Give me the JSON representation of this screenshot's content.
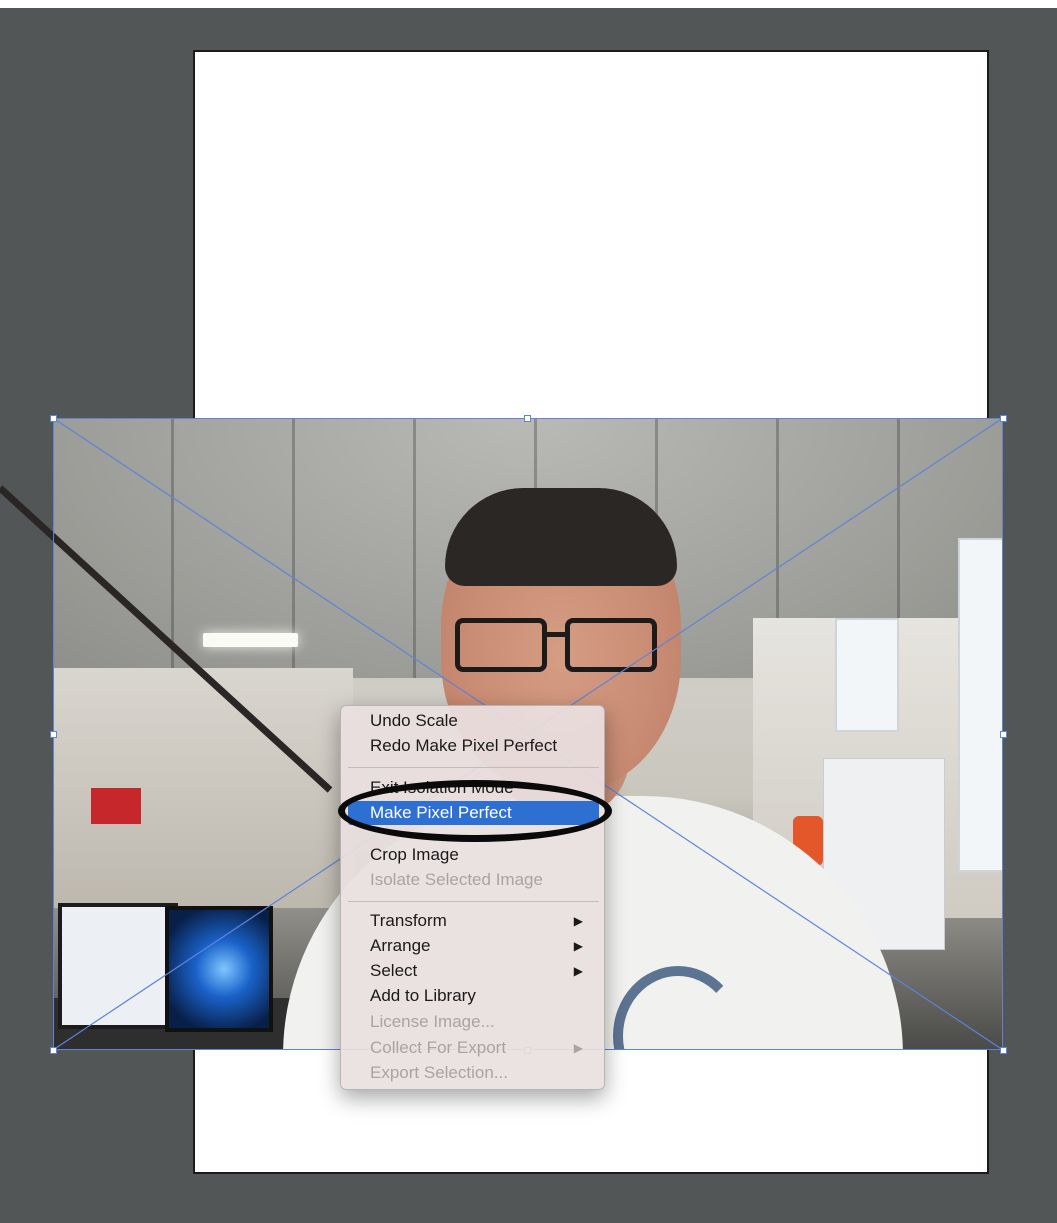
{
  "colors": {
    "workspace": "#535657",
    "artboard": "#ffffff",
    "selection": "#5f83d6",
    "menu_bg": "#e9e0e0",
    "menu_highlight": "#2e6fd2",
    "disabled_text": "#a9a4a3",
    "annotation": "#0a0a0a"
  },
  "context_menu": {
    "items": [
      {
        "label": "Undo Scale",
        "enabled": true
      },
      {
        "label": "Redo Make Pixel Perfect",
        "enabled": true
      },
      {
        "label": "Exit Isolation Mode",
        "enabled": true
      },
      {
        "label": "Make Pixel Perfect",
        "enabled": true,
        "highlighted": true
      },
      {
        "label": "Crop Image",
        "enabled": true
      },
      {
        "label": "Isolate Selected Image",
        "enabled": false
      },
      {
        "label": "Transform",
        "enabled": true,
        "submenu": true
      },
      {
        "label": "Arrange",
        "enabled": true,
        "submenu": true
      },
      {
        "label": "Select",
        "enabled": true,
        "submenu": true
      },
      {
        "label": "Add to Library",
        "enabled": true
      },
      {
        "label": "License Image...",
        "enabled": false
      },
      {
        "label": "Collect For Export",
        "enabled": false,
        "submenu": true
      },
      {
        "label": "Export Selection...",
        "enabled": false
      }
    ],
    "submenu_glyph": "▶"
  },
  "icons": [
    "submenu-arrow-icon"
  ]
}
